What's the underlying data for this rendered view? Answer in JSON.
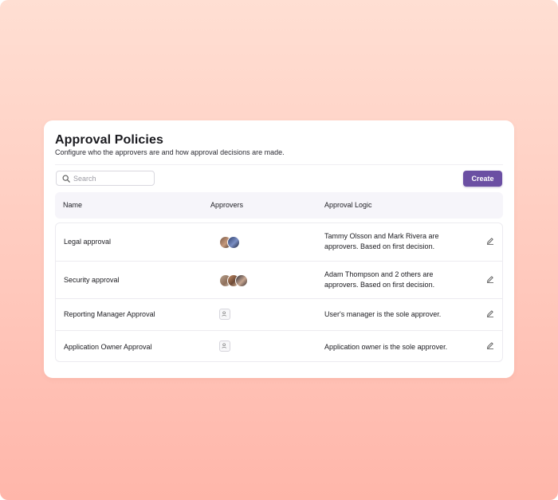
{
  "header": {
    "title": "Approval Policies",
    "subtitle": "Configure who the approvers are and how approval decisions are made."
  },
  "search": {
    "placeholder": "Search",
    "value": ""
  },
  "toolbar": {
    "create_label": "Create"
  },
  "table": {
    "columns": [
      "Name",
      "Approvers",
      "Approval Logic"
    ],
    "rows": [
      {
        "name": "Legal approval",
        "approvers": "photo-avatars-2",
        "logic": "Tammy Olsson and Mark Rivera are approvers. Based on first decision."
      },
      {
        "name": "Security approval",
        "approvers": "photo-avatars-3",
        "logic": "Adam Thompson and 2 others are approvers. Based on first decision."
      },
      {
        "name": "Reporting Manager Approval",
        "approvers": "user-placeholder-icon",
        "logic": "User's manager is the sole approver."
      },
      {
        "name": "Application Owner Approval",
        "approvers": "user-placeholder-icon",
        "logic": "Application owner is the sole approver."
      }
    ]
  },
  "colors": {
    "accent": "#6b4fa3",
    "background_top": "#ffdfd3",
    "background_bottom": "#ffb6aa"
  }
}
